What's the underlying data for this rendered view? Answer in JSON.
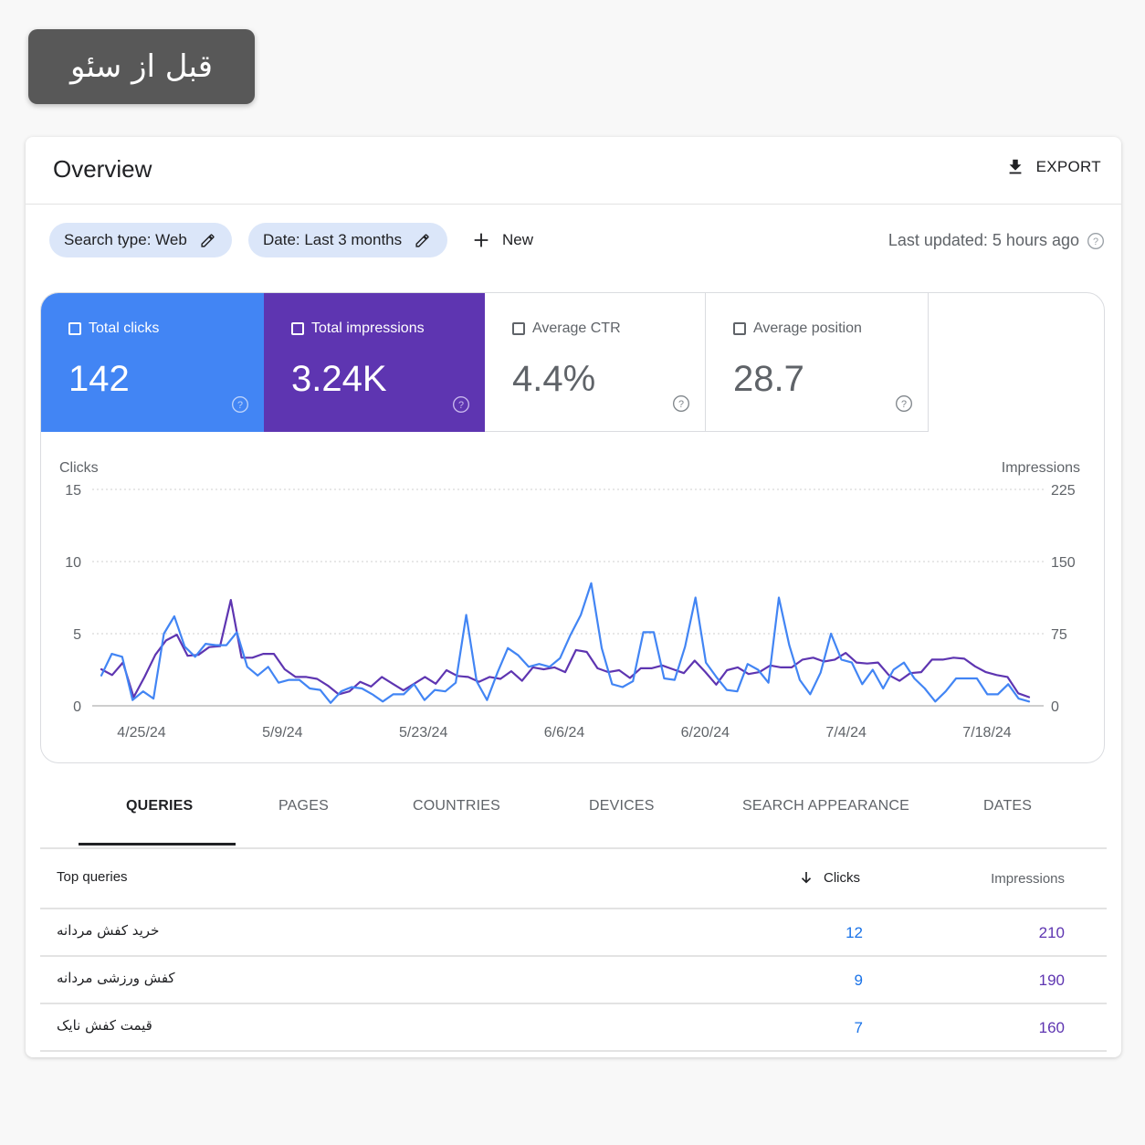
{
  "badge": {
    "text": "قبل از سئو"
  },
  "header": {
    "title": "Overview",
    "export_label": "EXPORT"
  },
  "filters": {
    "search_type": "Search type: Web",
    "date": "Date: Last 3 months",
    "new_label": "New",
    "last_updated": "Last updated: 5 hours ago"
  },
  "metrics": [
    {
      "label": "Total clicks",
      "value": "142"
    },
    {
      "label": "Total impressions",
      "value": "3.24K"
    },
    {
      "label": "Average CTR",
      "value": "4.4%"
    },
    {
      "label": "Average position",
      "value": "28.7"
    }
  ],
  "colors": {
    "clicks": "#4285f4",
    "impressions": "#5e35b1",
    "grid": "#cfcfcf"
  },
  "chart_data": {
    "type": "line",
    "left_axis_label": "Clicks",
    "right_axis_label": "Impressions",
    "left_ticks": [
      "15",
      "10",
      "5",
      "0"
    ],
    "right_ticks": [
      "225",
      "150",
      "75",
      "0"
    ],
    "left_ylim": [
      0,
      15
    ],
    "right_ylim": [
      0,
      225
    ],
    "x_ticks": [
      "4/25/24",
      "5/9/24",
      "5/23/24",
      "6/6/24",
      "6/20/24",
      "7/4/24",
      "7/18/24"
    ],
    "series": [
      {
        "name": "Clicks",
        "axis": "left",
        "values": [
          2.1,
          3.6,
          3.4,
          0.4,
          1.0,
          0.5,
          5.0,
          6.2,
          4.1,
          3.4,
          4.3,
          4.2,
          4.2,
          5.1,
          2.7,
          2.1,
          2.7,
          1.6,
          1.8,
          1.8,
          1.2,
          1.1,
          0.2,
          1.0,
          1.3,
          1.2,
          0.8,
          0.3,
          0.8,
          0.8,
          1.5,
          0.4,
          1.1,
          1.0,
          1.6,
          6.3,
          1.7,
          0.4,
          2.3,
          4.0,
          3.5,
          2.7,
          2.9,
          2.7,
          3.3,
          4.9,
          6.3,
          8.5,
          4.0,
          1.5,
          1.3,
          1.7,
          5.1,
          5.1,
          1.9,
          1.8,
          4.1,
          7.5,
          3.0,
          2.0,
          1.1,
          1.0,
          2.9,
          2.5,
          1.6,
          7.5,
          4.2,
          1.8,
          0.8,
          2.3,
          5.0,
          3.2,
          3.0,
          1.5,
          2.5,
          1.2,
          2.5,
          3.0,
          1.9,
          1.2,
          0.3,
          1.0,
          1.9,
          1.9,
          1.9,
          0.8,
          0.8,
          1.5,
          0.5,
          0.3
        ]
      },
      {
        "name": "Impressions",
        "axis": "right",
        "values": [
          38,
          32,
          45,
          9,
          30,
          53,
          68,
          74,
          52,
          53,
          61,
          62,
          110,
          50,
          50,
          54,
          54,
          38,
          30,
          30,
          28,
          21,
          12,
          15,
          25,
          20,
          30,
          23,
          16,
          23,
          30,
          23,
          37,
          31,
          30,
          25,
          30,
          28,
          36,
          26,
          40,
          38,
          40,
          35,
          58,
          56,
          39,
          35,
          37,
          29,
          39,
          39,
          42,
          38,
          34,
          47,
          35,
          22,
          37,
          40,
          33,
          35,
          42,
          40,
          40,
          48,
          50,
          46,
          48,
          55,
          45,
          44,
          45,
          32,
          26,
          34,
          35,
          48,
          48,
          50,
          49,
          41,
          35,
          32,
          30,
          13,
          9
        ]
      }
    ]
  },
  "tabs": [
    {
      "label": "QUERIES",
      "active": true
    },
    {
      "label": "PAGES"
    },
    {
      "label": "COUNTRIES"
    },
    {
      "label": "DEVICES"
    },
    {
      "label": "SEARCH APPEARANCE"
    },
    {
      "label": "DATES"
    }
  ],
  "table": {
    "col_query": "Top queries",
    "col_clicks": "Clicks",
    "col_impressions": "Impressions",
    "rows": [
      {
        "query": "خرید کفش مردانه",
        "clicks": "12",
        "impressions": "210"
      },
      {
        "query": "کفش ورزشی مردانه",
        "clicks": "9",
        "impressions": "190"
      },
      {
        "query": "قیمت کفش نایک",
        "clicks": "7",
        "impressions": "160"
      }
    ]
  }
}
